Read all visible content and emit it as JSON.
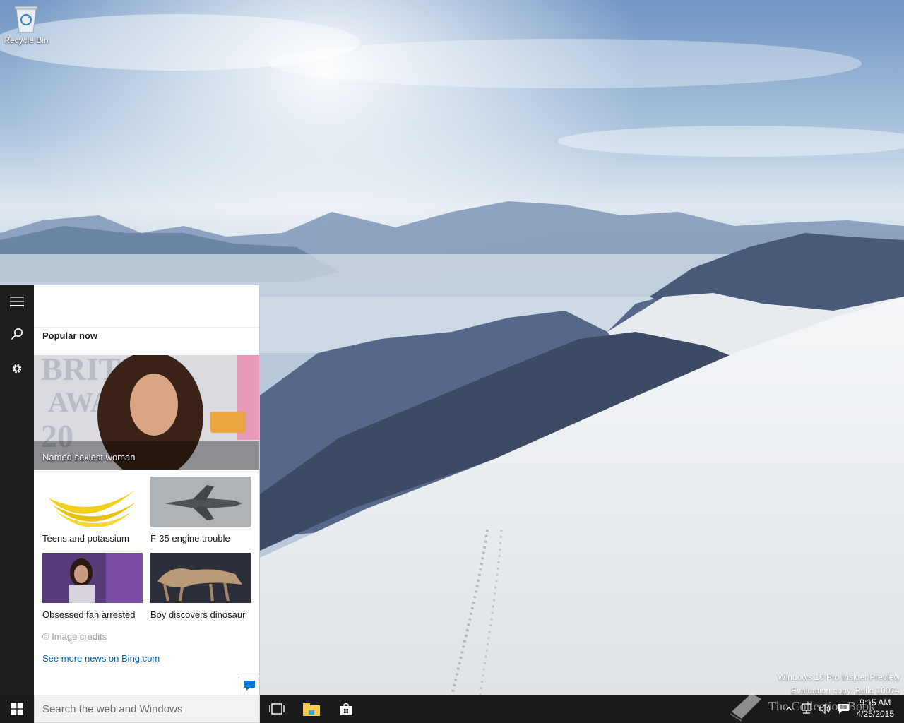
{
  "desktop": {
    "recycle_bin_label": "Recycle Bin",
    "watermark_line1": "Windows 10 Pro Insider Preview",
    "watermark_line2": "Evaluation copy. Build 10074"
  },
  "cortana": {
    "rail": {
      "menu_icon": "hamburger-menu-icon",
      "search_icon": "search-icon",
      "settings_icon": "gear-icon"
    },
    "section_title": "Popular now",
    "hero": {
      "caption": "Named sexiest woman"
    },
    "tiles": [
      {
        "caption": "Teens and potassium"
      },
      {
        "caption": "F-35 engine trouble"
      },
      {
        "caption": "Obsessed fan arrested"
      },
      {
        "caption": "Boy discovers dinosaur"
      }
    ],
    "image_credits": "© Image credits",
    "more_news_link": "See more news on Bing.com",
    "link_color": "#0063b1"
  },
  "taskbar": {
    "search_placeholder": "Search the web and Windows",
    "time": "9:15 AM",
    "date": "4/25/2015",
    "accent": "#0078d7"
  },
  "overlay": {
    "brand_text": "The Collection Book"
  }
}
